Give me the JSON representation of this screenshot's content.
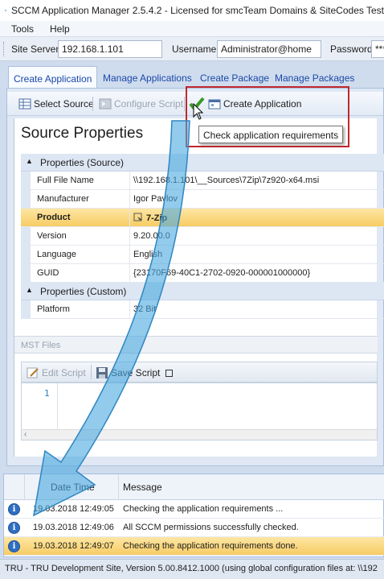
{
  "window": {
    "title": "SCCM Application Manager 2.5.4.2 - Licensed for smcTeam Domains & SiteCodes Test"
  },
  "menu": {
    "items": [
      "Tools",
      "Help"
    ]
  },
  "connection": {
    "site_server_label": "Site Server",
    "site_server_value": "192.168.1.101",
    "username_label": "Username",
    "username_value": "Administrator@home",
    "password_label": "Password",
    "password_value": "***"
  },
  "tabs": [
    "Create Application",
    "Manage Applications",
    "Create Package",
    "Manage Packages"
  ],
  "toolbar": {
    "select_source": "Select Source",
    "configure_script": "Configure Script",
    "create_application": "Create Application",
    "tooltip": "Check application requirements"
  },
  "source": {
    "title": "Source Properties",
    "category_source": "Properties (Source)",
    "category_custom": "Properties (Custom)",
    "rows": [
      {
        "key": "Full File Name",
        "value": "\\\\192.168.1.101\\__Sources\\7Zip\\7z920-x64.msi"
      },
      {
        "key": "Manufacturer",
        "value": "Igor Pavlov"
      },
      {
        "key": "Product",
        "value": "7-Zip"
      },
      {
        "key": "Version",
        "value": "9.20.00.0"
      },
      {
        "key": "Language",
        "value": "English"
      },
      {
        "key": "GUID",
        "value": "{23170F69-40C1-2702-0920-000001000000}"
      }
    ],
    "custom_rows": [
      {
        "key": "Platform",
        "value": "32 Bit"
      }
    ],
    "mst_label": "MST Files"
  },
  "editor": {
    "edit_script": "Edit Script",
    "save_script": "Save Script",
    "line_number": "1"
  },
  "log": {
    "col_date": "Date Time",
    "col_message": "Message",
    "rows": [
      {
        "date": "19.03.2018 12:49:05",
        "message": "Checking the application requirements ..."
      },
      {
        "date": "19.03.2018 12:49:06",
        "message": "All SCCM permissions successfully checked."
      },
      {
        "date": "19.03.2018 12:49:07",
        "message": "Checking the application requirements done."
      }
    ]
  },
  "status": {
    "text": "TRU - TRU Development Site, Version 5.00.8412.1000 (using global configuration files at: \\\\192"
  },
  "colors": {
    "accent": "#1a48a8",
    "highlight_border": "#c0282d",
    "selection": "#f7cc64",
    "arrow": "#4aa9e0"
  }
}
